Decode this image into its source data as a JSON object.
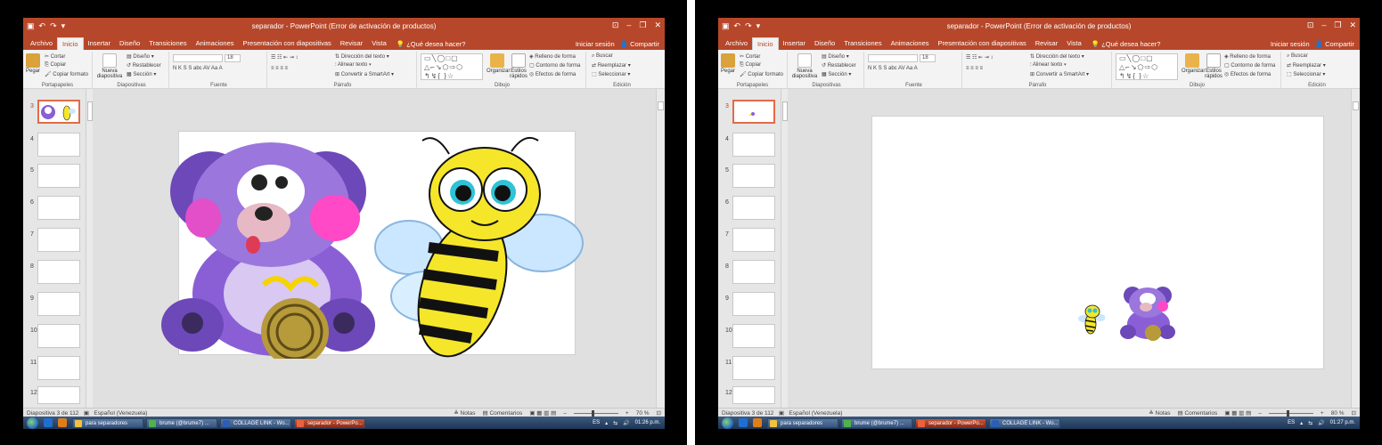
{
  "screens": [
    {
      "title": "separador - PowerPoint (Error de activación de productos)",
      "tabs": [
        "Archivo",
        "Inicio",
        "Insertar",
        "Diseño",
        "Transiciones",
        "Animaciones",
        "Presentación con diapositivas",
        "Revisar",
        "Vista"
      ],
      "active_tab": "Inicio",
      "tell_me": "¿Qué desea hacer?",
      "account": [
        "Iniciar sesión",
        "Compartir"
      ],
      "ribbon": {
        "clipboard": {
          "paste": "Pegar",
          "cut": "Cortar",
          "copy": "Copiar",
          "format": "Copiar formato",
          "caption": "Portapapeles"
        },
        "slides": {
          "new": "Nueva diapositiva",
          "layout": "Diseño",
          "reset": "Restablecer",
          "section": "Sección",
          "caption": "Diapositivas"
        },
        "font": {
          "size": "18",
          "caption": "Fuente",
          "styles": "N K S S abc AV Aa A"
        },
        "paragraph": {
          "direction": "Dirección del texto",
          "align": "Alinear texto",
          "smartart": "Convertir a SmartArt",
          "caption": "Párrafo"
        },
        "drawing": {
          "arrange": "Organizar",
          "quick_styles": "Estilos rápidos",
          "fill": "Relleno de forma",
          "outline": "Contorno de forma",
          "effects": "Efectos de forma",
          "caption": "Dibujo"
        },
        "editing": {
          "find": "Buscar",
          "replace": "Reemplazar",
          "select": "Seleccionar",
          "caption": "Edición"
        }
      },
      "thumb_numbers": [
        "3",
        "4",
        "5",
        "6",
        "7",
        "8",
        "9",
        "10",
        "11",
        "12"
      ],
      "status_left": "Diapositiva 3 de 112",
      "language": "Español (Venezuela)",
      "notes": "Notas",
      "comments": "Comentarios",
      "zoom": "70 %",
      "taskbar": [
        "para separadores",
        "brume (@brume7) ...",
        "COLLAGE LINK - Wo...",
        "separador - PowerPo..."
      ],
      "tray_lang": "ES",
      "clock": "01:26 p.m."
    },
    {
      "title": "separador - PowerPoint (Error de activación de productos)",
      "tabs": [
        "Archivo",
        "Inicio",
        "Insertar",
        "Diseño",
        "Transiciones",
        "Animaciones",
        "Presentación con diapositivas",
        "Revisar",
        "Vista"
      ],
      "active_tab": "Inicio",
      "tell_me": "¿Qué desea hacer?",
      "account": [
        "Iniciar sesión",
        "Compartir"
      ],
      "ribbon": {
        "clipboard": {
          "paste": "Pegar",
          "cut": "Cortar",
          "copy": "Copiar",
          "format": "Copiar formato",
          "caption": "Portapapeles"
        },
        "slides": {
          "new": "Nueva diapositiva",
          "layout": "Diseño",
          "reset": "Restablecer",
          "section": "Sección",
          "caption": "Diapositivas"
        },
        "font": {
          "size": "18",
          "caption": "Fuente",
          "styles": "N K S S abc AV Aa A"
        },
        "paragraph": {
          "direction": "Dirección del texto",
          "align": "Alinear texto",
          "smartart": "Convertir a SmartArt",
          "caption": "Párrafo"
        },
        "drawing": {
          "arrange": "Organizar",
          "quick_styles": "Estilos rápidos",
          "fill": "Relleno de forma",
          "outline": "Contorno de forma",
          "effects": "Efectos de forma",
          "caption": "Dibujo"
        },
        "editing": {
          "find": "Buscar",
          "replace": "Reemplazar",
          "select": "Seleccionar",
          "caption": "Edición"
        }
      },
      "thumb_numbers": [
        "3",
        "4",
        "5",
        "6",
        "7",
        "8",
        "9",
        "10",
        "11",
        "12"
      ],
      "status_left": "Diapositiva 3 de 112",
      "language": "Español (Venezuela)",
      "notes": "Notas",
      "comments": "Comentarios",
      "zoom": "80 %",
      "taskbar": [
        "para separadores",
        "brume (@brume7) ...",
        "separador - PowerPo...",
        "COLLAGE LINK - Wo..."
      ],
      "tray_lang": "ES",
      "clock": "01:27 p.m."
    }
  ],
  "colors": {
    "accent": "#b7472a",
    "bear": "#8a5fd6",
    "bee": "#f5e62a"
  }
}
